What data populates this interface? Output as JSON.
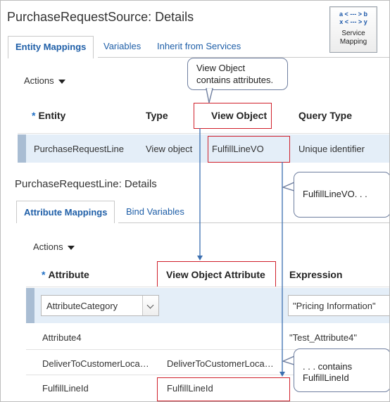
{
  "page": {
    "title": "PurchaseRequestSource: Details"
  },
  "service_mapping_button": {
    "map_line1": "a < --- > b",
    "map_line2": "x < --- > y",
    "label_line1": "Service",
    "label_line2": "Mapping"
  },
  "tabs": [
    "Entity Mappings",
    "Variables",
    "Inherit from Services"
  ],
  "entity_section": {
    "actions_label": "Actions",
    "columns": [
      "Entity",
      "Type",
      "View Object",
      "Query Type"
    ],
    "rows": [
      {
        "entity": "PurchaseRequestLine",
        "type": "View object",
        "view_object": "FulfillLineVO",
        "query_type": "Unique identifier"
      }
    ]
  },
  "details_section": {
    "title": "PurchaseRequestLine: Details",
    "tabs": [
      "Attribute Mappings",
      "Bind Variables"
    ],
    "actions_label": "Actions",
    "columns": [
      "Attribute",
      "View Object Attribute",
      "Expression"
    ],
    "rows": [
      {
        "attribute": "AttributeCategory",
        "view_object_attribute": "",
        "expression": "\"Pricing Information\""
      },
      {
        "attribute": "Attribute4",
        "view_object_attribute": "",
        "expression": "\"Test_Attribute4\""
      },
      {
        "attribute": "DeliverToCustomerLoca…",
        "view_object_attribute": "DeliverToCustomerLoca…",
        "expression": ""
      },
      {
        "attribute": "FulfillLineId",
        "view_object_attribute": "FulfillLineId",
        "expression": ""
      }
    ]
  },
  "callouts": {
    "view_object": {
      "line1": "View Object",
      "line2": "contains attributes."
    },
    "fulfill_vo": "FulfillLineVO. . .",
    "contains": {
      "line1": ". . . contains",
      "line2": "FulfillLineId"
    }
  },
  "colors": {
    "link": "#1f5fa8",
    "highlight_box": "#d0202b",
    "selected_row": "#e4eef8",
    "connector": "#3b6fb0"
  }
}
